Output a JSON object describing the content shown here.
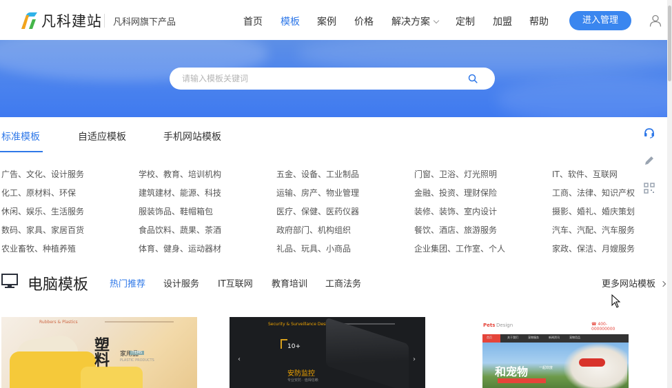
{
  "header": {
    "brand": "凡科建站",
    "brand_sub": "凡科网旗下产品",
    "nav": [
      {
        "label": "首页",
        "active": false
      },
      {
        "label": "模板",
        "active": true
      },
      {
        "label": "案例",
        "active": false
      },
      {
        "label": "价格",
        "active": false
      },
      {
        "label": "解决方案",
        "active": false,
        "dropdown": true
      },
      {
        "label": "定制",
        "active": false
      },
      {
        "label": "加盟",
        "active": false
      },
      {
        "label": "帮助",
        "active": false
      }
    ],
    "enter_button": "进入管理",
    "accent_color": "#2f78e8"
  },
  "search": {
    "placeholder": "请输入模板关键词",
    "value": ""
  },
  "tabs": [
    {
      "label": "标准模板",
      "active": true
    },
    {
      "label": "自适应模板",
      "active": false
    },
    {
      "label": "手机网站模板",
      "active": false
    }
  ],
  "side_tools": [
    "headset-icon",
    "pencil-icon",
    "qrcode-icon"
  ],
  "categories": [
    [
      "广告、文化、设计服务",
      "学校、教育、培训机构",
      "五金、设备、工业制品",
      "门窗、卫浴、灯光照明",
      "IT、软件、互联网"
    ],
    [
      "化工、原材料、环保",
      "建筑建材、能源、科技",
      "运输、房产、物业管理",
      "金融、投资、理财保险",
      "工商、法律、知识产权"
    ],
    [
      "休闲、娱乐、生活服务",
      "服装饰品、鞋帽箱包",
      "医疗、保健、医药仪器",
      "装修、装饰、室内设计",
      "摄影、婚礼、婚庆策划"
    ],
    [
      "数码、家具、家居百货",
      "食品饮料、蔬果、茶酒",
      "政府部门、机构组织",
      "餐饮、酒店、旅游服务",
      "汽车、汽配、汽车服务"
    ],
    [
      "农业畜牧、种植养殖",
      "体育、健身、运动器材",
      "礼品、玩具、小商品",
      "企业集团、工作室、个人",
      "家政、保洁、月嫂服务"
    ]
  ],
  "section": {
    "title": "电脑模板",
    "tabs": [
      {
        "label": "热门推荐",
        "active": true
      },
      {
        "label": "设计服务",
        "active": false
      },
      {
        "label": "IT互联网",
        "active": false
      },
      {
        "label": "教育培训",
        "active": false
      },
      {
        "label": "工商法务",
        "active": false
      }
    ],
    "more": "更多网站模板"
  },
  "cards": [
    {
      "head": "Rubbers & Plastics",
      "big": "塑料",
      "label": "家用品",
      "tag": "ITEMS",
      "sub": "PLASTIC PRODUCTS"
    },
    {
      "logo": "Security & Surveillance Design",
      "num": "10+",
      "title": "安防监控",
      "sub": "专业安防 · 值得信赖"
    },
    {
      "logo": "Pets",
      "logo2": "Design",
      "phone": "☎ 400-000000000",
      "nav": [
        "首页",
        "关于我们",
        "宠物服务",
        "新闻资讯",
        "宠物用品"
      ],
      "title": "和宠物",
      "sub": "一起欢度"
    }
  ]
}
